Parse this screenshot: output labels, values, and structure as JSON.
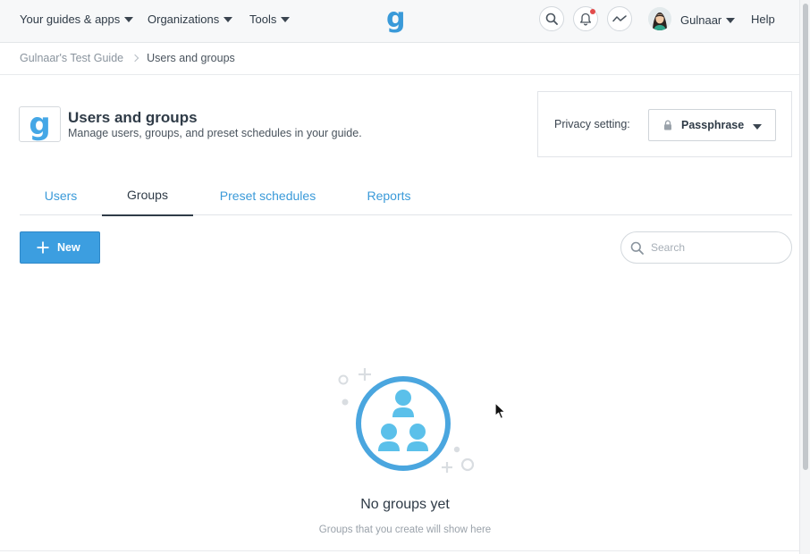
{
  "topnav": {
    "guides_apps": "Your guides & apps",
    "organizations": "Organizations",
    "tools": "Tools",
    "logo_letter": "g",
    "user_name": "Gulnaar",
    "help": "Help",
    "icons": [
      "search-icon",
      "bell-icon",
      "activity-icon"
    ]
  },
  "breadcrumb": {
    "parent": "Gulnaar's Test Guide",
    "current": "Users and groups"
  },
  "header": {
    "logo_letter": "g",
    "title": "Users and groups",
    "subtitle": "Manage users, groups, and preset schedules in your guide."
  },
  "privacy": {
    "label": "Privacy setting:",
    "value": "Passphrase"
  },
  "tabs": [
    {
      "label": "Users",
      "active": false
    },
    {
      "label": "Groups",
      "active": true
    },
    {
      "label": "Preset schedules",
      "active": false
    },
    {
      "label": "Reports",
      "active": false
    }
  ],
  "toolbar": {
    "new_label": "New",
    "search_placeholder": "Search"
  },
  "empty_state": {
    "title": "No groups yet",
    "subtitle": "Groups that you create will show here"
  },
  "colors": {
    "accent": "#3a9ad9",
    "primary_button": "#3c9ee0",
    "illustration_ring": "#4aa6df",
    "illustration_people": "#5bc0ea",
    "notification": "#e24b4b"
  }
}
